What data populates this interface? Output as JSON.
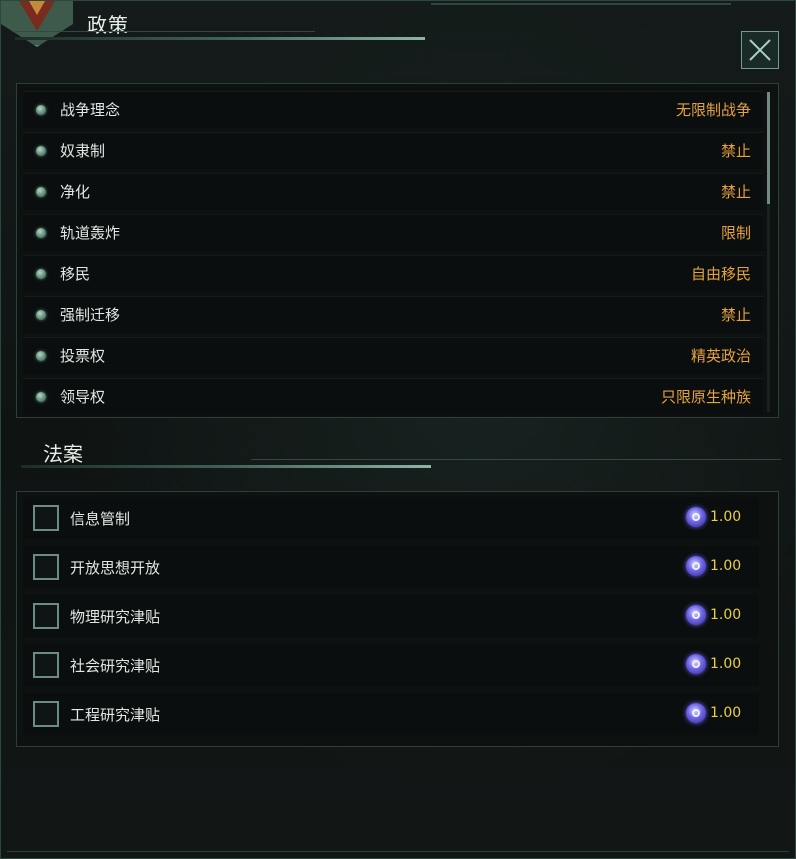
{
  "window": {
    "title": "政策",
    "close_icon": "close-x-icon"
  },
  "policies": [
    {
      "name": "战争理念",
      "value": "无限制战争"
    },
    {
      "name": "奴隶制",
      "value": "禁止"
    },
    {
      "name": "净化",
      "value": "禁止"
    },
    {
      "name": "轨道轰炸",
      "value": "限制"
    },
    {
      "name": "移民",
      "value": "自由移民"
    },
    {
      "name": "强制迁移",
      "value": "禁止"
    },
    {
      "name": "投票权",
      "value": "精英政治"
    },
    {
      "name": "领导权",
      "value": "只限原生种族"
    }
  ],
  "edicts_section": {
    "title": "法案"
  },
  "edicts": [
    {
      "name": "信息管制",
      "cost": "1.00",
      "checked": false
    },
    {
      "name": "开放思想开放",
      "cost": "1.00",
      "checked": false
    },
    {
      "name": "物理研究津贴",
      "cost": "1.00",
      "checked": false
    },
    {
      "name": "社会研究津贴",
      "cost": "1.00",
      "checked": false
    },
    {
      "name": "工程研究津贴",
      "cost": "1.00",
      "checked": false
    }
  ],
  "colors": {
    "policy_value": "#e7a23c",
    "cost_value": "#e8d048",
    "accent": "#6f9c8c",
    "influence_icon": "#6d63e6"
  },
  "icons": {
    "policy_bullet": "green-dot-icon",
    "cost": "influence-icon",
    "emblem": "empire-emblem-icon"
  }
}
